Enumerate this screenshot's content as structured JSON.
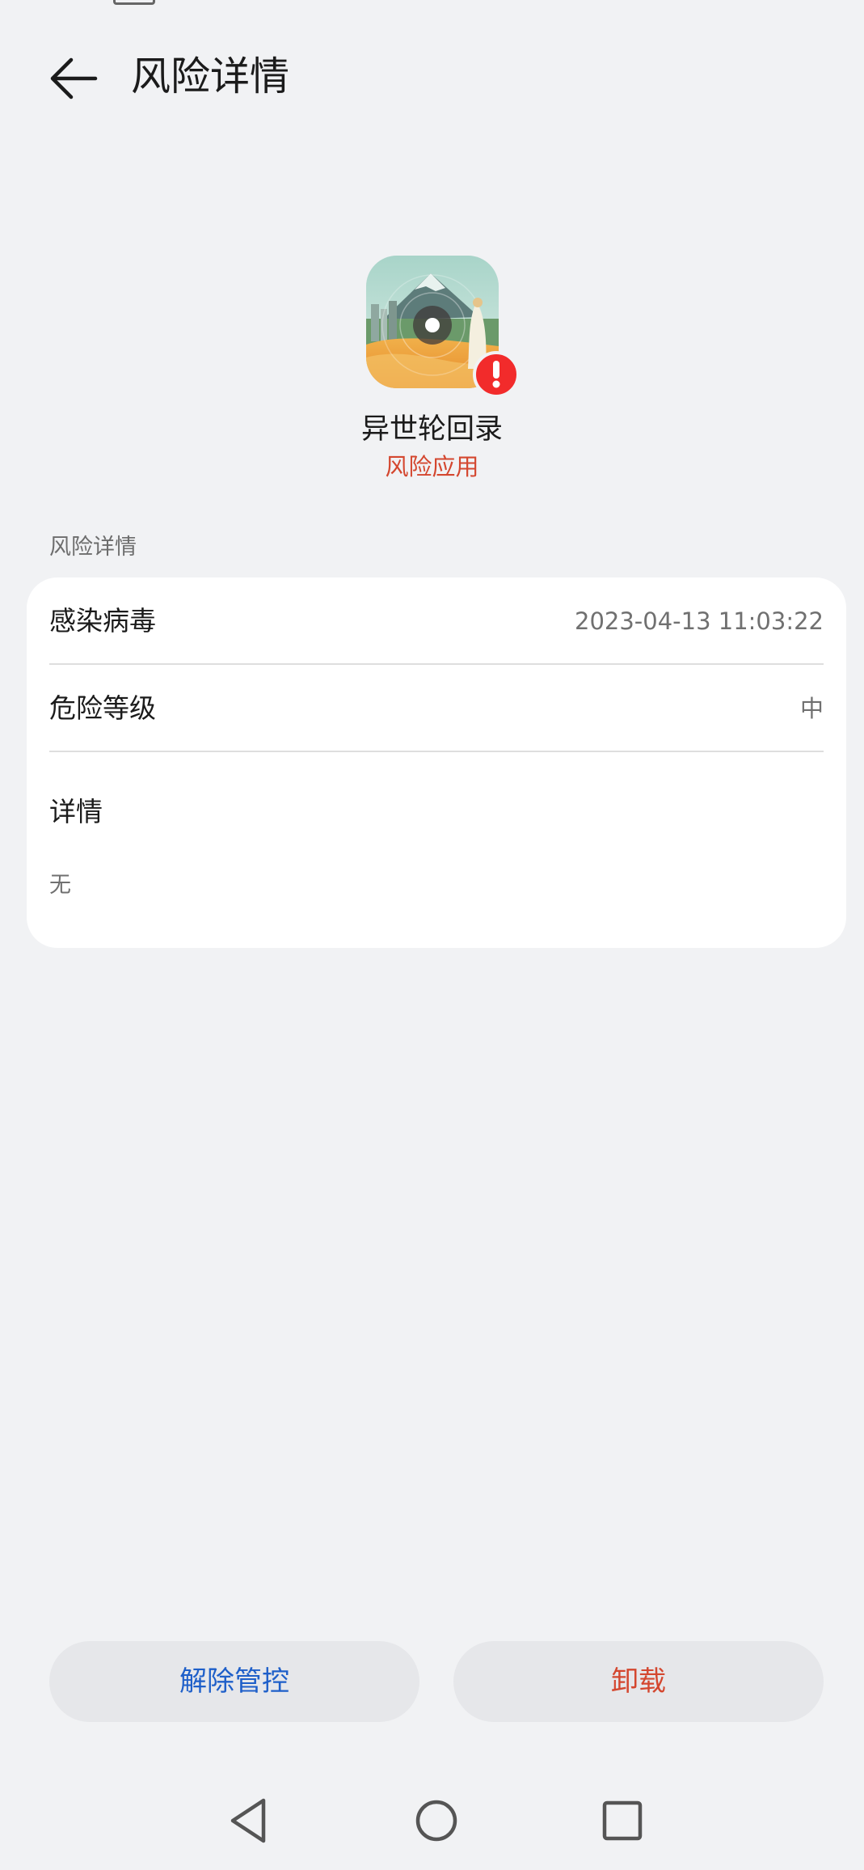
{
  "header": {
    "title": "风险详情"
  },
  "app": {
    "name": "异世轮回录",
    "risk_label": "风险应用",
    "icon": "app-icon",
    "badge_icon": "exclamation-icon"
  },
  "section": {
    "label": "风险详情"
  },
  "details": {
    "rows": [
      {
        "label": "感染病毒",
        "value": "2023-04-13 11:03:22"
      },
      {
        "label": "危险等级",
        "value": "中"
      }
    ],
    "detail_title": "详情",
    "detail_text": "无"
  },
  "actions": {
    "release_label": "解除管控",
    "uninstall_label": "卸载"
  },
  "colors": {
    "background": "#f1f2f4",
    "risk_red": "#d4472f",
    "link_blue": "#1e5fc9",
    "badge_red": "#f22b2b"
  },
  "navbar": {
    "back_icon": "triangle-back-icon",
    "home_icon": "circle-home-icon",
    "recent_icon": "square-recent-icon"
  }
}
